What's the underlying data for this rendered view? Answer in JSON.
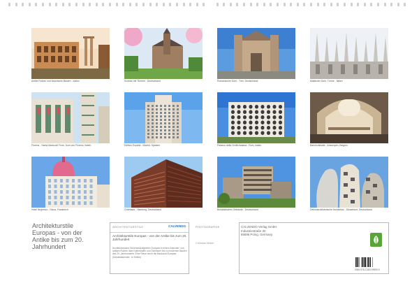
{
  "photos": [
    {
      "caption": "Antike Ruinen und historische Bauten - Italien",
      "scene": "colosseum"
    },
    {
      "caption": "Schloss mit Türmen - Deutschland",
      "scene": "castle"
    },
    {
      "caption": "Romanischer Dom - Trier, Deutschland",
      "scene": "cathedral"
    },
    {
      "caption": "Mailänder Dom, Türme - Italien",
      "scene": "gothic"
    },
    {
      "caption": "Florenz - Santa Maria del Fiore, Dom von Florenz, Italien",
      "scene": "florence"
    },
    {
      "caption": "Edificio España - Madrid, Spanien",
      "scene": "tower"
    },
    {
      "caption": "Palazzo della Civiltà Italiana - Rom, Italien",
      "scene": "square"
    },
    {
      "caption": "Bahnhofshalle - Antwerpen, Belgien",
      "scene": "station"
    },
    {
      "caption": "Hotel Negresco - Nizza, Frankreich",
      "scene": "negresco"
    },
    {
      "caption": "Chilehaus - Hamburg, Deutschland",
      "scene": "brick"
    },
    {
      "caption": "Brutalistisches Gebäude - Deutschland",
      "scene": "brutal"
    },
    {
      "caption": "Dekonstruktivistische Architektur - Düsseldorf, Deutschland",
      "scene": "gehry"
    }
  ],
  "title": {
    "lines": [
      "Architekturstile",
      "Europas - von der",
      "Antike bis zum 20.",
      "Jahrhundert"
    ]
  },
  "infobox": {
    "header": "ARCHITEKTURSTILE",
    "logo": "CALVENDO",
    "subtitle": "Architekturstile Europas - von der Antike bis zum 20. Jahrhundert",
    "description": "Architektonische Sehenswürdigkeiten Europas in einem Kalender: von antiken Ruinen über Kathedralen und Schlösser bis zu modernen Bauten des 20. Jahrhunderts. Eine Reise durch die Baukunst Europas. (Monatskalender, 14 Seiten)"
  },
  "mid": {
    "label": "PHOTOGRAPHIE",
    "author": "Christian Müller"
  },
  "publisher": {
    "line1": "CALVENDO Verlag GmbH",
    "line2": "Industriestraße 30",
    "line3": "85586 Poing, Germany",
    "isbn": "ISBN 978-3-383-99999-9"
  }
}
